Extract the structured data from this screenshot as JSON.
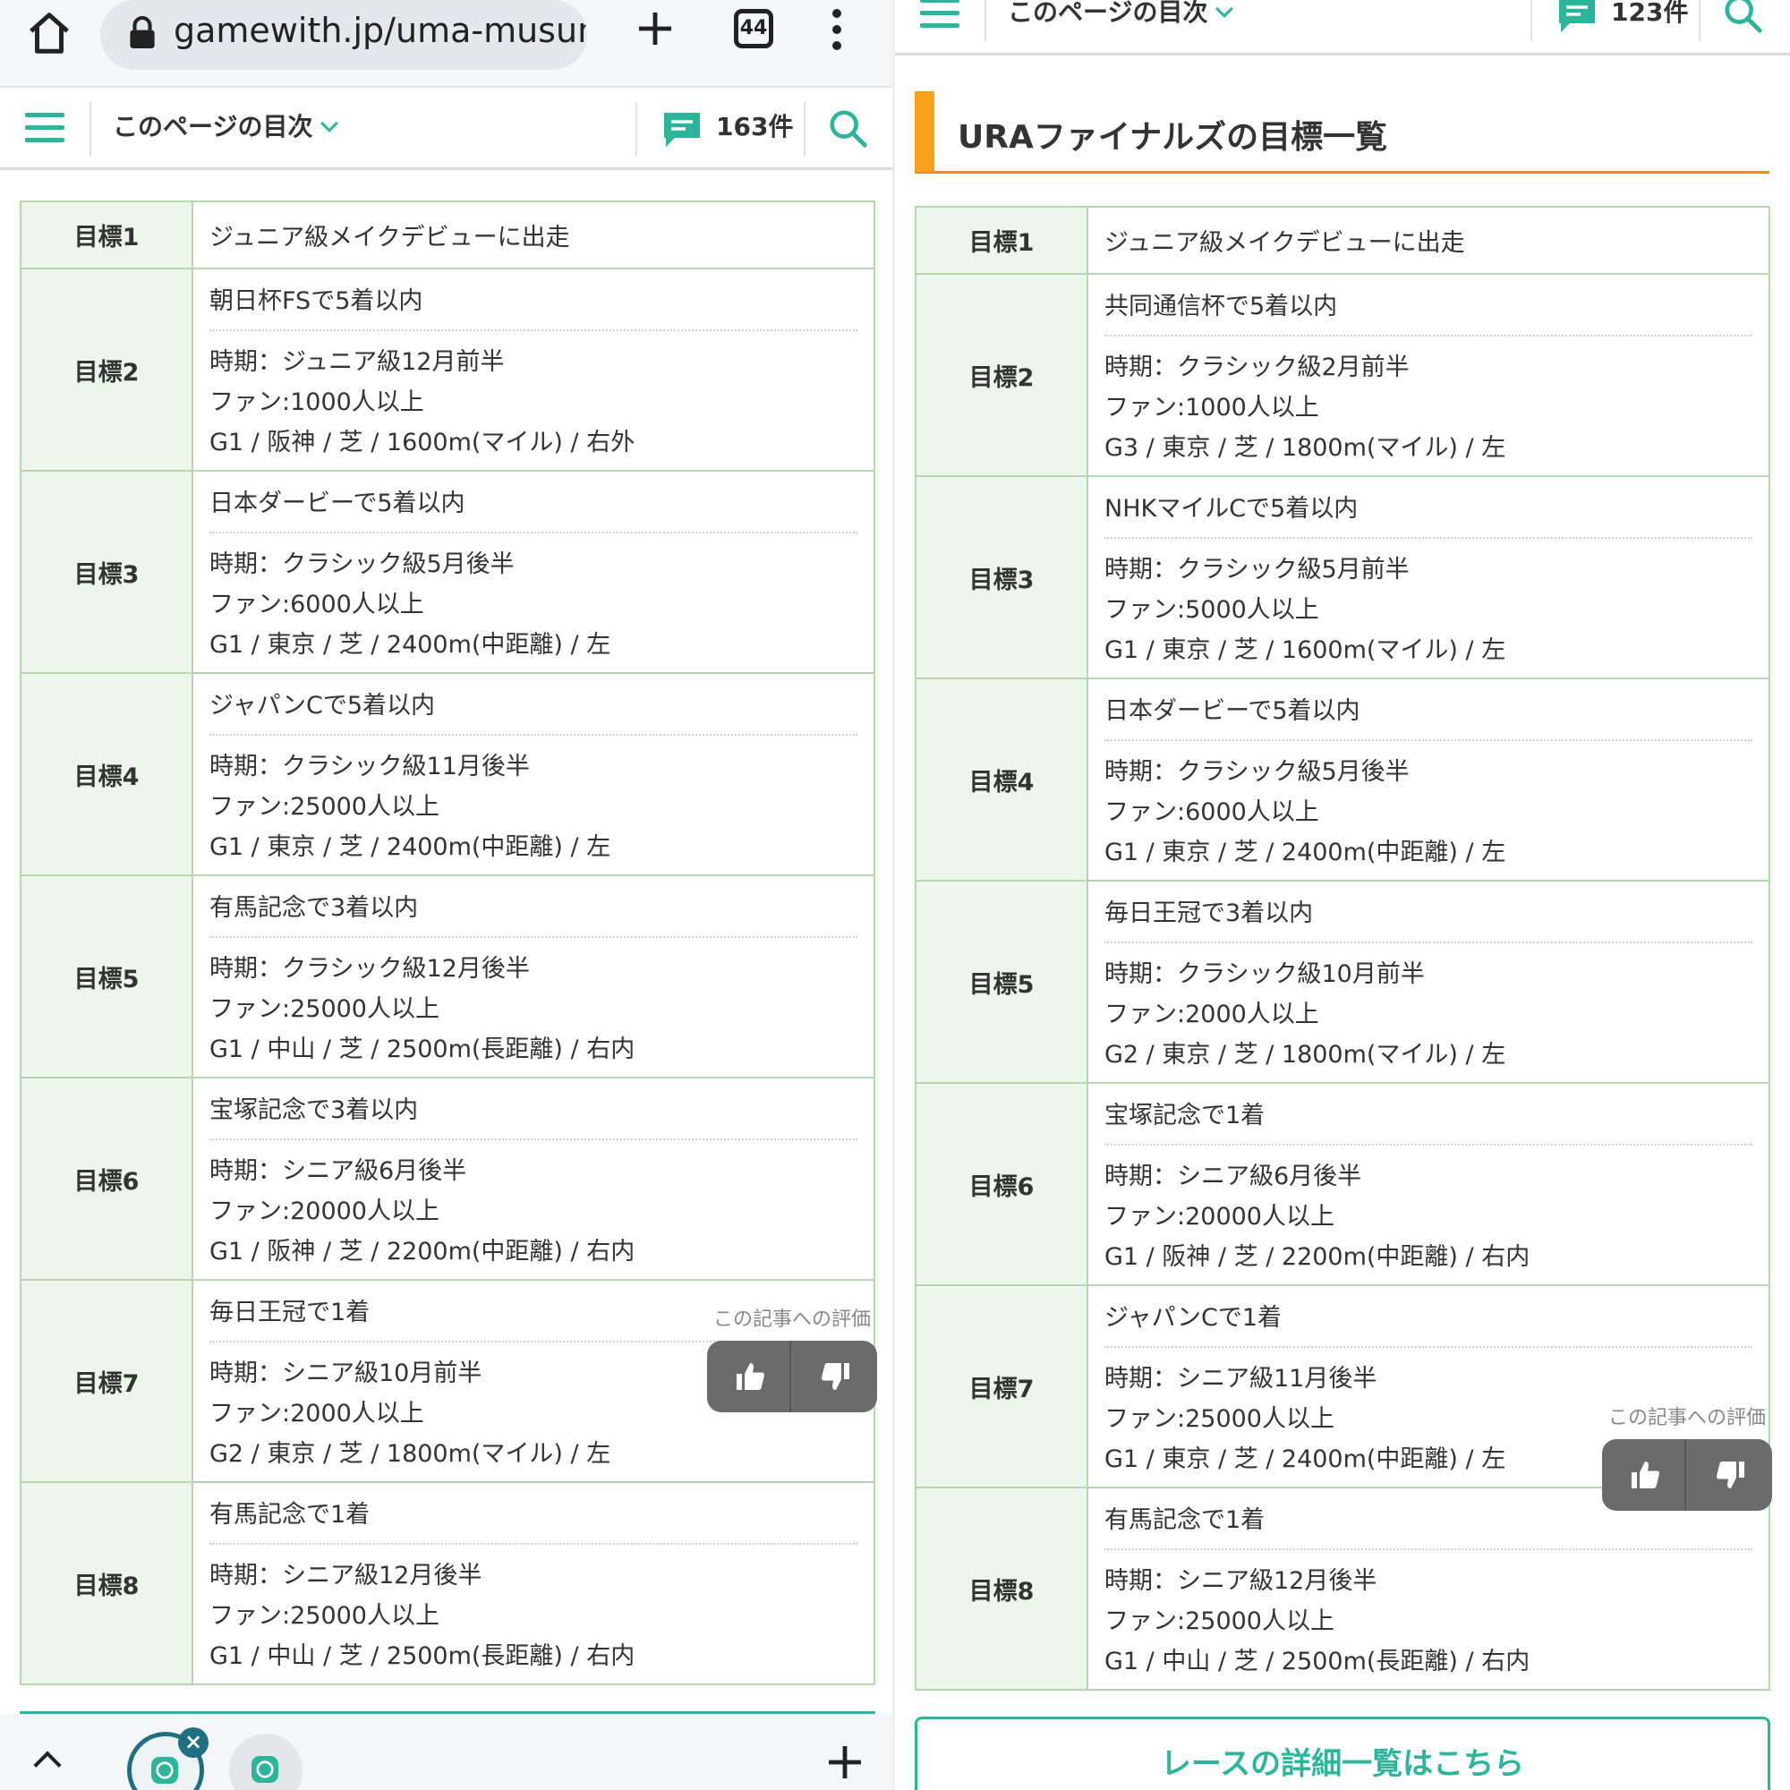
{
  "browser": {
    "url": "gamewith.jp/uma-musume",
    "tab_count": "44"
  },
  "left": {
    "header": {
      "toc_label": "このページの目次",
      "comment_count": "163件"
    },
    "goals": [
      {
        "label": "目標1",
        "condition": "ジュニア級メイクデビューに出走"
      },
      {
        "label": "目標2",
        "condition": "朝日杯FSで5着以内",
        "period": "時期：ジュニア級12月前半",
        "fans": "ファン:1000人以上",
        "race": "G1 / 阪神 / 芝 / 1600m(マイル) / 右外"
      },
      {
        "label": "目標3",
        "condition": "日本ダービーで5着以内",
        "period": "時期：クラシック級5月後半",
        "fans": "ファン:6000人以上",
        "race": "G1 / 東京 / 芝 / 2400m(中距離) / 左"
      },
      {
        "label": "目標4",
        "condition": "ジャパンCで5着以内",
        "period": "時期：クラシック級11月後半",
        "fans": "ファン:25000人以上",
        "race": "G1 / 東京 / 芝 / 2400m(中距離) / 左"
      },
      {
        "label": "目標5",
        "condition": "有馬記念で3着以内",
        "period": "時期：クラシック級12月後半",
        "fans": "ファン:25000人以上",
        "race": "G1 / 中山 / 芝 / 2500m(長距離) / 右内"
      },
      {
        "label": "目標6",
        "condition": "宝塚記念で3着以内",
        "period": "時期：シニア級6月後半",
        "fans": "ファン:20000人以上",
        "race": "G1 / 阪神 / 芝 / 2200m(中距離) / 右内"
      },
      {
        "label": "目標7",
        "condition": "毎日王冠で1着",
        "period": "時期：シニア級10月前半",
        "fans": "ファン:2000人以上",
        "race": "G2 / 東京 / 芝 / 1800m(マイル) / 左"
      },
      {
        "label": "目標8",
        "condition": "有馬記念で1着",
        "period": "時期：シニア級12月後半",
        "fans": "ファン:25000人以上",
        "race": "G1 / 中山 / 芝 / 2500m(長距離) / 右内"
      }
    ],
    "rating_label": "この記事への評価"
  },
  "right": {
    "header": {
      "toc_label": "このページの目次",
      "comment_count": "123件"
    },
    "section_title": "URAファイナルズの目標一覧",
    "goals": [
      {
        "label": "目標1",
        "condition": "ジュニア級メイクデビューに出走"
      },
      {
        "label": "目標2",
        "condition": "共同通信杯で5着以内",
        "period": "時期：クラシック級2月前半",
        "fans": "ファン:1000人以上",
        "race": "G3 / 東京 / 芝 / 1800m(マイル) / 左"
      },
      {
        "label": "目標3",
        "condition": "NHKマイルCで5着以内",
        "period": "時期：クラシック級5月前半",
        "fans": "ファン:5000人以上",
        "race": "G1 / 東京 / 芝 / 1600m(マイル) / 左"
      },
      {
        "label": "目標4",
        "condition": "日本ダービーで5着以内",
        "period": "時期：クラシック級5月後半",
        "fans": "ファン:6000人以上",
        "race": "G1 / 東京 / 芝 / 2400m(中距離) / 左"
      },
      {
        "label": "目標5",
        "condition": "毎日王冠で3着以内",
        "period": "時期：クラシック級10月前半",
        "fans": "ファン:2000人以上",
        "race": "G2 / 東京 / 芝 / 1800m(マイル) / 左"
      },
      {
        "label": "目標6",
        "condition": "宝塚記念で1着",
        "period": "時期：シニア級6月後半",
        "fans": "ファン:20000人以上",
        "race": "G1 / 阪神 / 芝 / 2200m(中距離) / 右内"
      },
      {
        "label": "目標7",
        "condition": "ジャパンCで1着",
        "period": "時期：シニア級11月後半",
        "fans": "ファン:25000人以上",
        "race": "G1 / 東京 / 芝 / 2400m(中距離) / 左"
      },
      {
        "label": "目標8",
        "condition": "有馬記念で1着",
        "period": "時期：シニア級12月後半",
        "fans": "ファン:25000人以上",
        "race": "G1 / 中山 / 芝 / 2500m(長距離) / 右内"
      }
    ],
    "rating_label": "この記事への評価",
    "race_list_button": "レースの詳細一覧はこちら"
  },
  "colors": {
    "accent": "#2bb59a",
    "heading_accent": "#f08a1d",
    "table_border": "#b7d7ae",
    "table_header_bg": "#edf6ea"
  },
  "icons": [
    "home-icon",
    "lock-icon",
    "plus-icon",
    "tab-switcher-icon",
    "kebab-menu-icon",
    "hamburger-menu-icon",
    "comment-icon",
    "search-icon",
    "thumbs-up-icon",
    "thumbs-down-icon",
    "chat-bubble-icon",
    "close-icon",
    "chevron-up-icon"
  ]
}
